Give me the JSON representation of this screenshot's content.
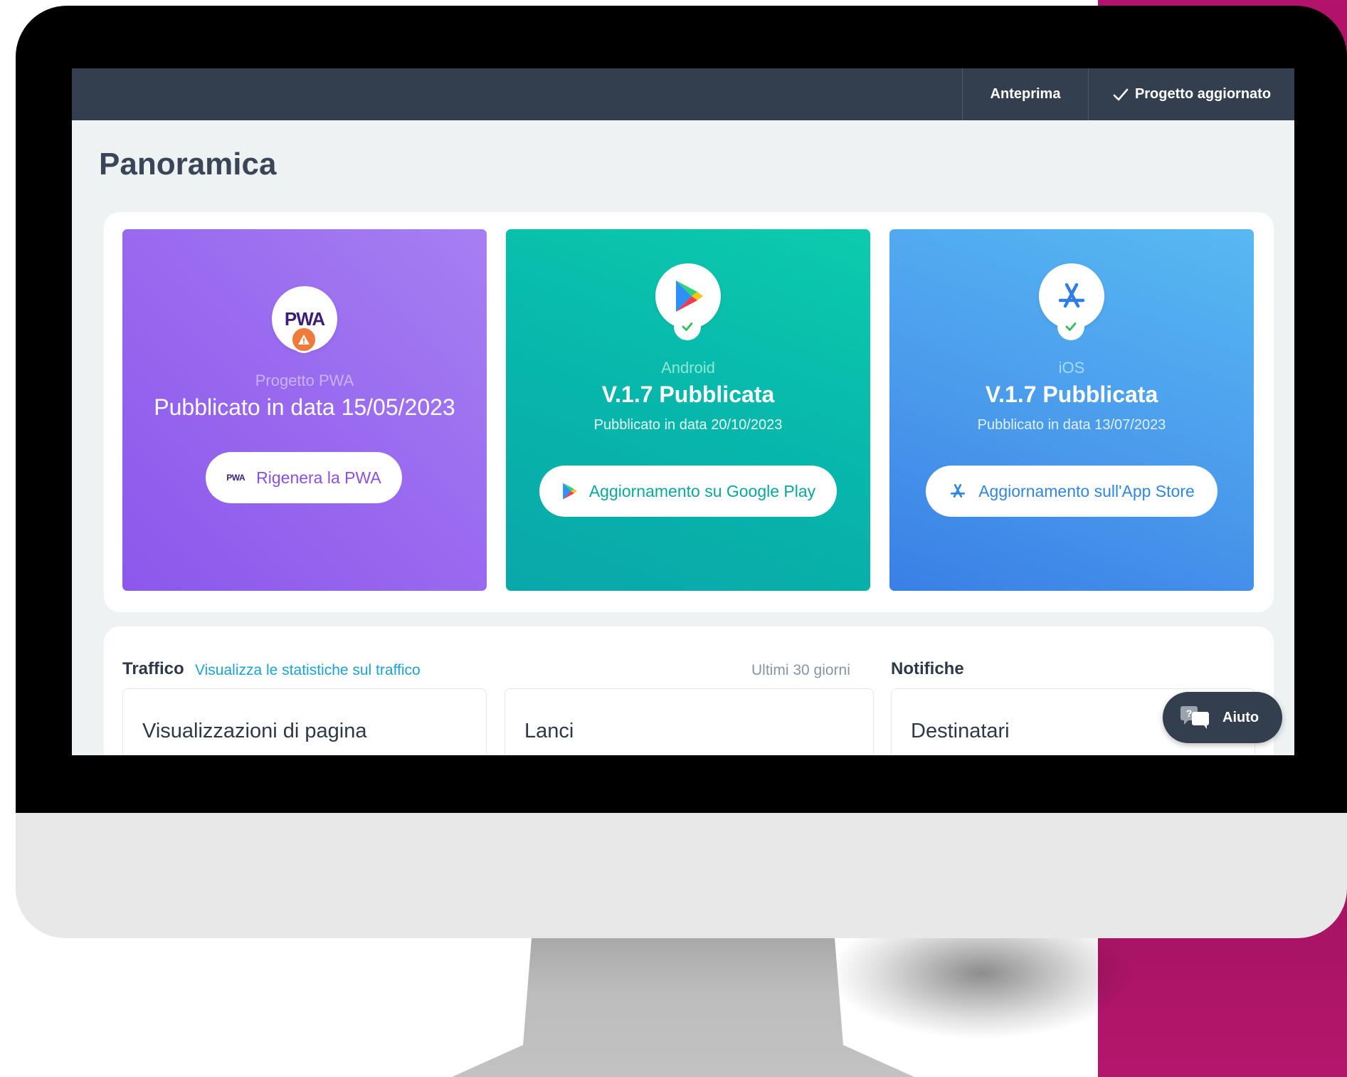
{
  "topbar": {
    "preview_label": "Anteprima",
    "status_label": "Progetto aggiornato"
  },
  "page": {
    "title": "Panoramica"
  },
  "cards": {
    "pwa": {
      "logo_text": "PWA",
      "platform": "Progetto PWA",
      "headline": "Pubblicato in data 15/05/2023",
      "button_label": "Rigenera la PWA",
      "button_icon_text": "PWA",
      "status": "warning",
      "accent": "#9b6cf0"
    },
    "android": {
      "platform": "Android",
      "headline": "V.1.7 Pubblicata",
      "subline": "Pubblicato in data 20/10/2023",
      "button_label": "Aggiornamento su Google Play",
      "icon": "google-play-icon",
      "status": "ok",
      "accent": "#07b7ab"
    },
    "ios": {
      "platform": "iOS",
      "headline": "V.1.7 Pubblicata",
      "subline": "Pubblicato in data 13/07/2023",
      "button_label": "Aggiornamento sull'App Store",
      "icon": "app-store-icon",
      "status": "ok",
      "accent": "#3a85e8"
    }
  },
  "traffic": {
    "label": "Traffico",
    "link_label": "Visualizza le statistiche sul traffico",
    "range_label": "Ultimi 30 giorni",
    "stats": [
      "Visualizzazioni di pagina",
      "Lanci"
    ]
  },
  "notifications": {
    "label": "Notifiche",
    "stats": [
      "Destinatari"
    ]
  },
  "help": {
    "label": "Aiuto"
  }
}
